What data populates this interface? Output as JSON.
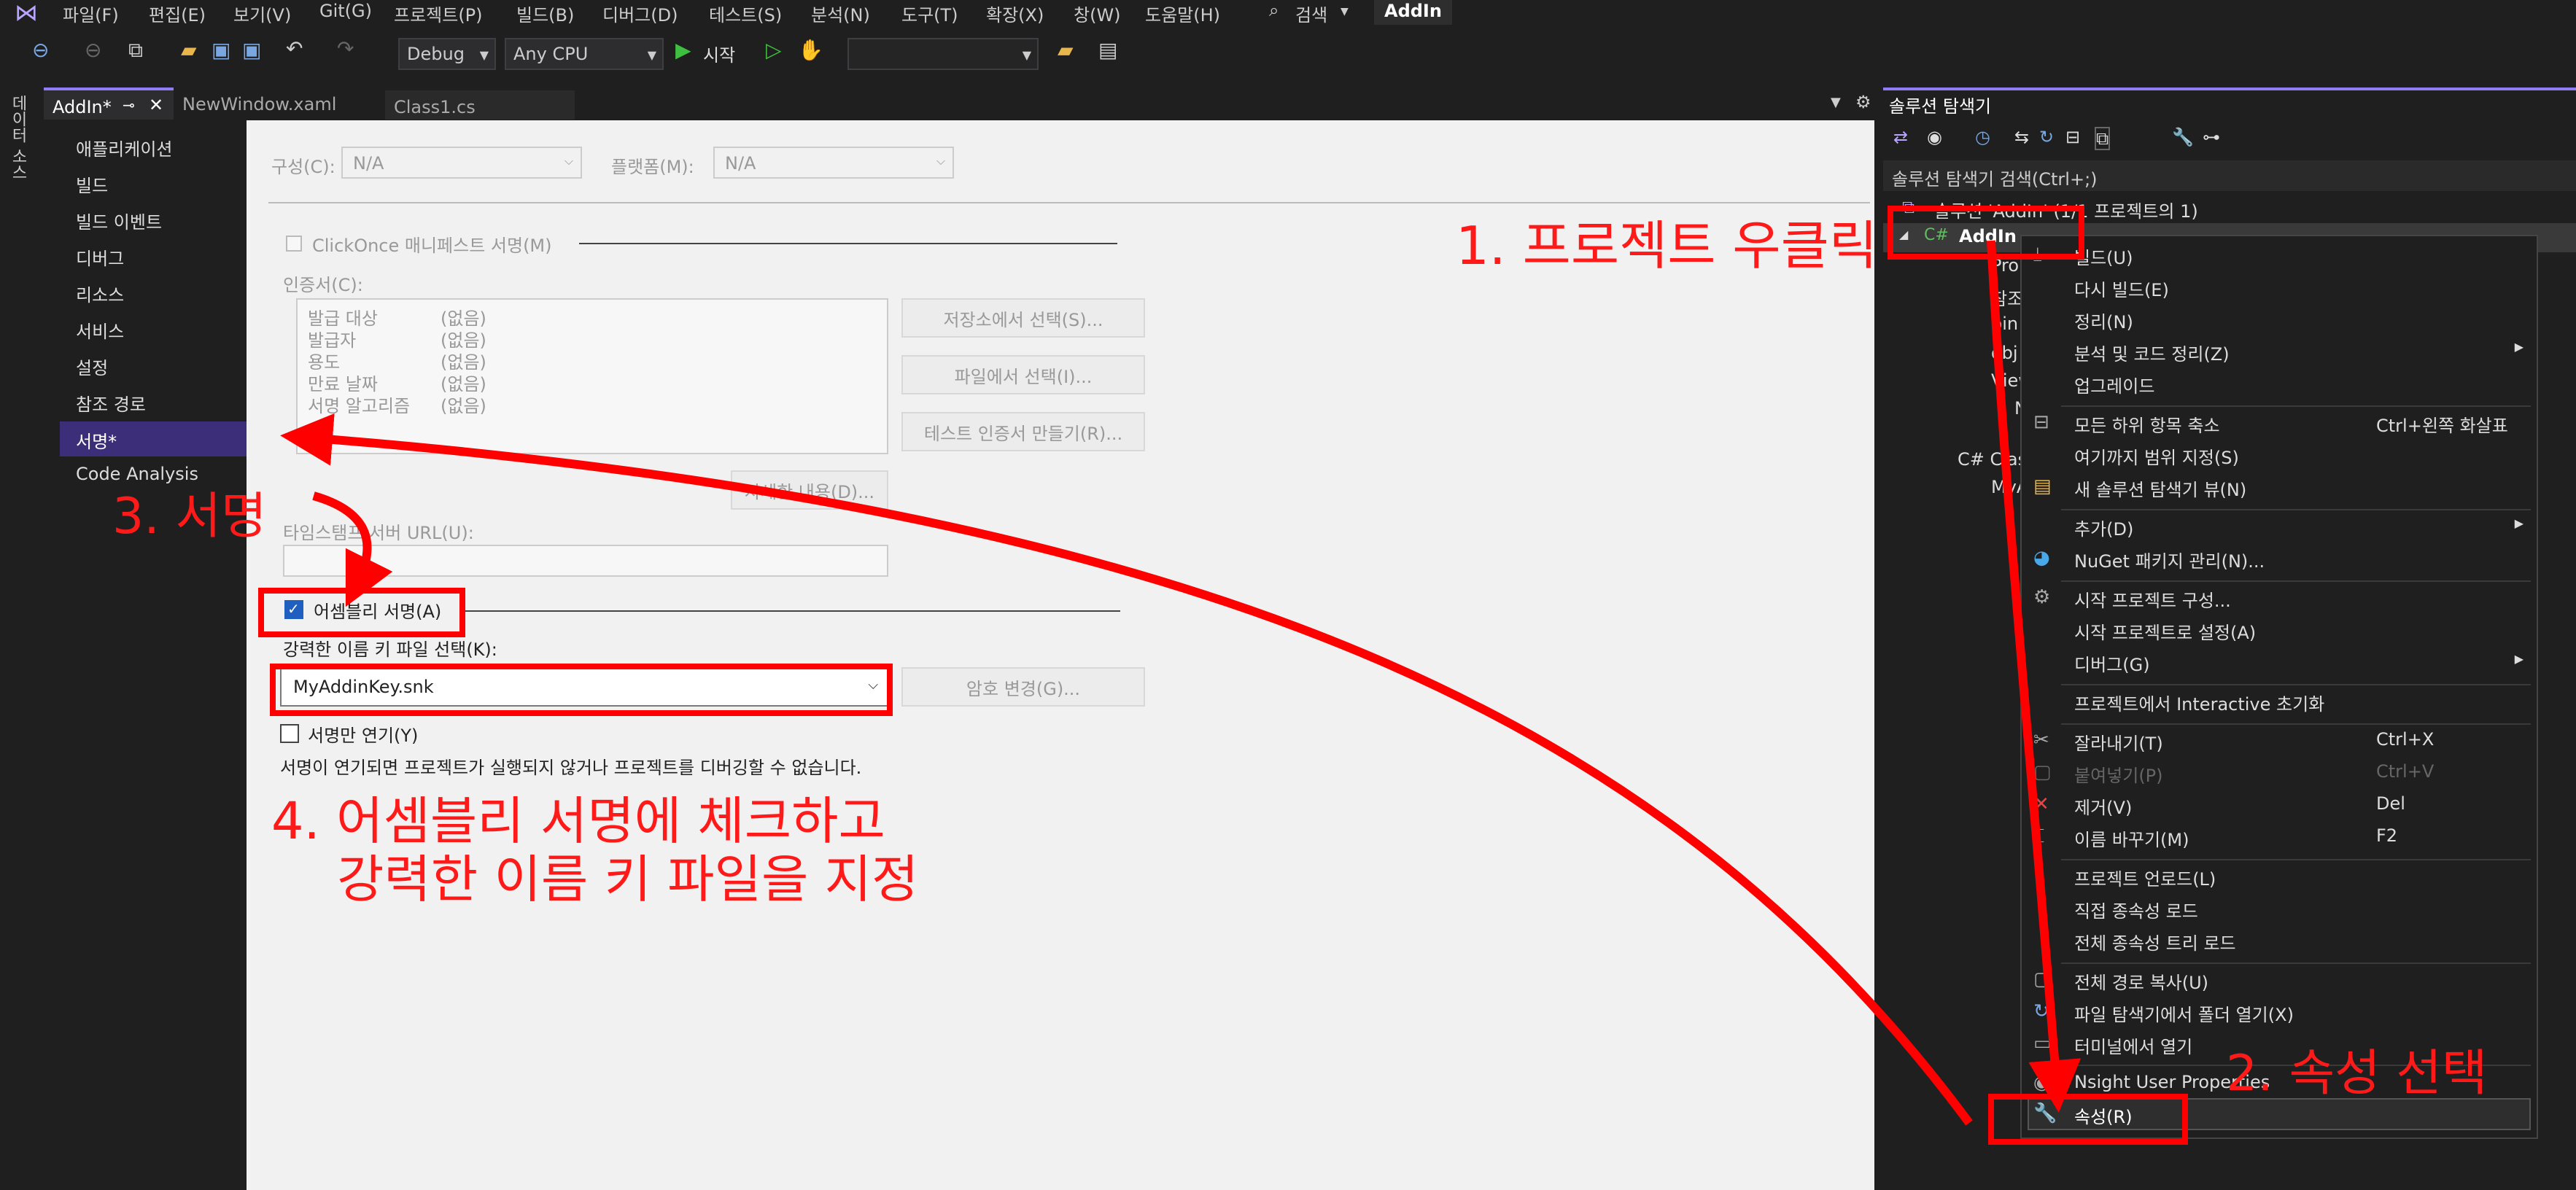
{
  "menubar": {
    "items": [
      "파일(F)",
      "편집(E)",
      "보기(V)",
      "Git(G)",
      "프로젝트(P)",
      "빌드(B)",
      "디버그(D)",
      "테스트(S)",
      "분석(N)",
      "도구(T)",
      "확장(X)",
      "창(W)",
      "도움말(H)"
    ],
    "search": "검색",
    "project": "AddIn"
  },
  "toolbar": {
    "config": "Debug",
    "platform": "Any CPU",
    "start": "시작"
  },
  "tabs": [
    "AddIn*",
    "NewWindow.xaml",
    "Class1.cs"
  ],
  "leftstrip": "데이터 소스",
  "proptree": {
    "items": [
      "애플리케이션",
      "빌드",
      "빌드 이벤트",
      "디버그",
      "리소스",
      "서비스",
      "설정",
      "참조 경로",
      "서명*",
      "Code Analysis"
    ]
  },
  "signing": {
    "config_label": "구성(C):",
    "config_value": "N/A",
    "platform_label": "플랫폼(M):",
    "platform_value": "N/A",
    "clickonce": "ClickOnce 매니페스트 서명(M)",
    "cert_label": "인증서(C):",
    "cert_rows": [
      [
        "발급 대상",
        "(없음)"
      ],
      [
        "발급자",
        "(없음)"
      ],
      [
        "용도",
        "(없음)"
      ],
      [
        "만료 날짜",
        "(없음)"
      ],
      [
        "서명 알고리즘",
        "(없음)"
      ]
    ],
    "btn_store": "저장소에서 선택(S)...",
    "btn_file": "파일에서 선택(I)...",
    "btn_test": "테스트 인증서 만들기(R)...",
    "btn_detail": "자세한 내용(D)...",
    "timestamp": "타임스탬프 서버 URL(U):",
    "assembly": "어셈블리 서명(A)",
    "keyfile_label": "강력한 이름 키 파일 선택(K):",
    "keyfile_value": "MyAddinKey.snk",
    "btn_password": "암호 변경(G)...",
    "delay": "서명만 연기(Y)",
    "delay_note": "서명이 연기되면 프로젝트가 실행되지 않거나 프로젝트를 디버깅할 수 없습니다."
  },
  "solution_explorer": {
    "title": "솔루션 탐색기",
    "search": "솔루션 탐색기 검색(Ctrl+;)",
    "solution": "솔루션 'AddIn' (1/1 프로젝트의 1)",
    "project": "AddIn",
    "nodes": [
      "Prop",
      "참조",
      "bin",
      "obj",
      "View",
      "N",
      "C# Clas",
      "MyA"
    ]
  },
  "context_menu": {
    "items": [
      {
        "label": "빌드(U)",
        "shortcut": ""
      },
      {
        "label": "다시 빌드(E)",
        "shortcut": ""
      },
      {
        "label": "정리(N)",
        "shortcut": ""
      },
      {
        "label": "분석 및 코드 정리(Z)",
        "shortcut": ""
      },
      {
        "label": "업그레이드",
        "shortcut": ""
      },
      {
        "label": "모든 하위 항목 축소",
        "shortcut": "Ctrl+왼쪽 화살표"
      },
      {
        "label": "여기까지 범위 지정(S)",
        "shortcut": ""
      },
      {
        "label": "새 솔루션 탐색기 뷰(N)",
        "shortcut": ""
      },
      {
        "label": "추가(D)",
        "shortcut": ""
      },
      {
        "label": "NuGet 패키지 관리(N)...",
        "shortcut": ""
      },
      {
        "label": "시작 프로젝트 구성...",
        "shortcut": ""
      },
      {
        "label": "시작 프로젝트로 설정(A)",
        "shortcut": ""
      },
      {
        "label": "디버그(G)",
        "shortcut": ""
      },
      {
        "label": "프로젝트에서 Interactive 초기화",
        "shortcut": ""
      },
      {
        "label": "잘라내기(T)",
        "shortcut": "Ctrl+X"
      },
      {
        "label": "붙여넣기(P)",
        "shortcut": "Ctrl+V"
      },
      {
        "label": "제거(V)",
        "shortcut": "Del"
      },
      {
        "label": "이름 바꾸기(M)",
        "shortcut": "F2"
      },
      {
        "label": "프로젝트 언로드(L)",
        "shortcut": ""
      },
      {
        "label": "직접 종속성 로드",
        "shortcut": ""
      },
      {
        "label": "전체 종속성 트리 로드",
        "shortcut": ""
      },
      {
        "label": "전체 경로 복사(U)",
        "shortcut": ""
      },
      {
        "label": "파일 탐색기에서 폴더 열기(X)",
        "shortcut": ""
      },
      {
        "label": "터미널에서 열기",
        "shortcut": ""
      },
      {
        "label": "Nsight User Properties",
        "shortcut": ""
      },
      {
        "label": "속성(R)",
        "shortcut": ""
      }
    ]
  },
  "annotations": {
    "a1": "1. 프로젝트 우클릭",
    "a2": "2. 속성 선택",
    "a3": "3. 서명",
    "a4_line1": "4. 어셈블리 서명에 체크하고",
    "a4_line2": "강력한 이름 키 파일을 지정"
  }
}
